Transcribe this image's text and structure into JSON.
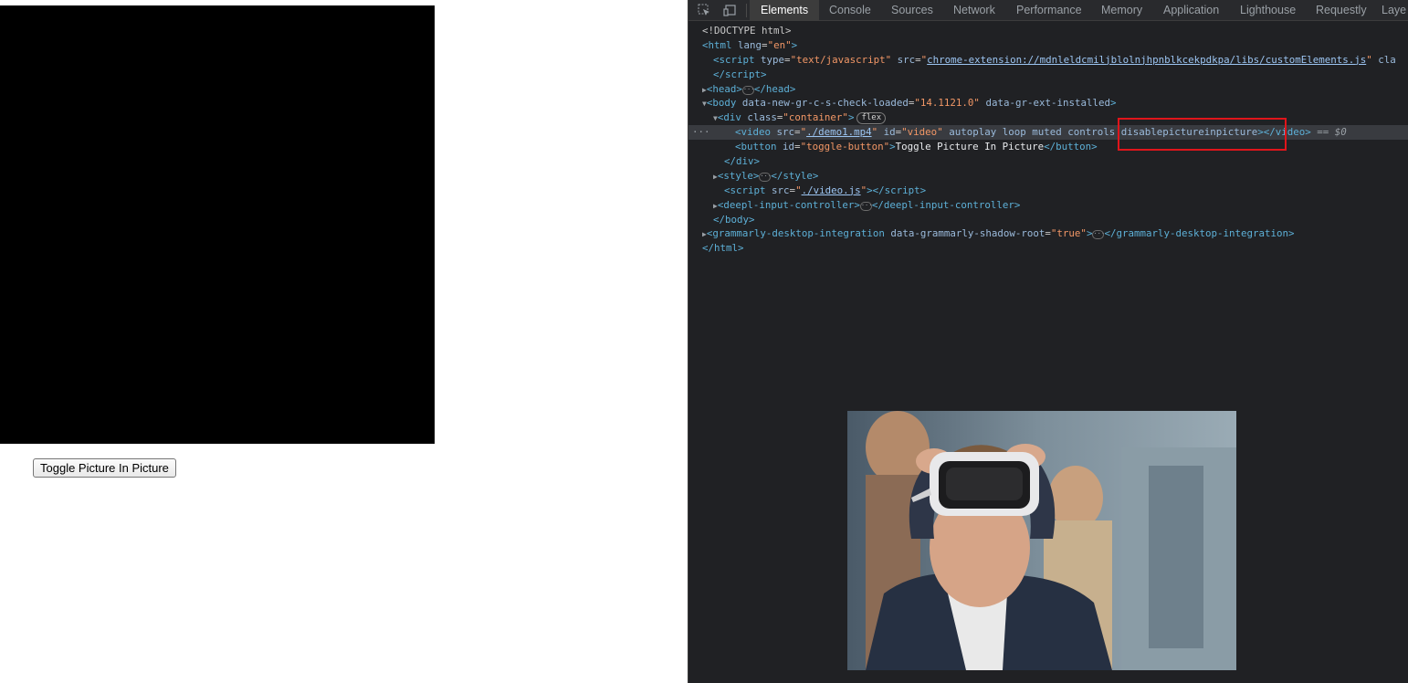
{
  "page": {
    "toggle_button_label": "Toggle Picture In Picture"
  },
  "devtools": {
    "tabs": [
      "Elements",
      "Console",
      "Sources",
      "Network",
      "Performance",
      "Memory",
      "Application",
      "Lighthouse",
      "Requestly",
      "Laye"
    ],
    "active_tab": "Elements",
    "tree": {
      "doctype": "<!DOCTYPE html>",
      "html_lang": "en",
      "script_type": "text/javascript",
      "script_src": "chrome-extension://mdnleldcmiljblolnjhpnblkcekpdkpa/libs/customElements.js",
      "script_tail": "cla",
      "body_attr_value": "14.1121.0",
      "container_class": "container",
      "flex_badge": "flex",
      "video_src": "./demo1.mp4",
      "video_id": "video",
      "video_bool_attrs": "autoplay loop muted controls",
      "video_disable_attr": "disablepictureinpicture",
      "selected_marker": "== $0",
      "button_id": "toggle-button",
      "button_text": "Toggle Picture In Picture",
      "video_js_src": "./video.js",
      "grammarly_attr_value": "true"
    }
  },
  "colors": {
    "highlight": "#e0151b",
    "devtools_bg": "#202124"
  }
}
